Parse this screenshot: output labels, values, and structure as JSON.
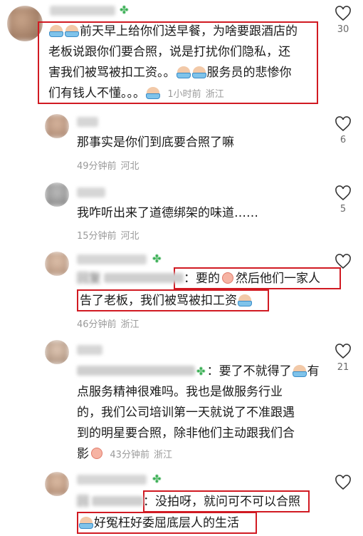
{
  "comments": [
    {
      "text_lines": [
        "前天早上给你们送早餐，为啥要跟酒店的",
        "老板说跟你们要合照，说是打扰你们隐私，还",
        "害我们被骂被扣工资。。",
        "服务员的悲惨你",
        "们有钱人不懂。。。"
      ],
      "time": "1小时前",
      "location": "浙江",
      "likes": "30"
    },
    {
      "text": "那事实是你们到底要合照了嘛",
      "time": "49分钟前",
      "location": "河北",
      "likes": "6"
    },
    {
      "text": "我咋听出来了道德绑架的味道……",
      "time": "15分钟前",
      "location": "河北",
      "likes": "5"
    },
    {
      "prefix": "回复",
      "line1": "：要的",
      "line1b": "然后他们一家人",
      "line2": "告了老板，我们被骂被扣工资",
      "time": "46分钟前",
      "location": "浙江",
      "likes": ""
    },
    {
      "line1": "：要了不就得了",
      "line1b": "有",
      "lines": [
        "点服务精神很难吗。我也是做服务行业",
        "的，我们公司培训第一天就说了不准跟遇",
        "到的明星要合照，除非他们主动跟我们合"
      ],
      "line5": "影",
      "time": "43分钟前",
      "location": "浙江",
      "likes": "21"
    },
    {
      "prefix": "回",
      "line1": "：没拍呀，就问可不可以合照",
      "line2": "好冤枉好委屈底层人的生活",
      "likes": ""
    }
  ],
  "icons": {
    "like": "heart-outline-icon",
    "clover": "four-leaf-clover-icon",
    "emoji_cry": "crying-face-emoji",
    "emoji_blush": "shy-face-emoji"
  },
  "colors": {
    "highlight_box": "#d11a22",
    "meta_text": "#9a9a9a"
  }
}
